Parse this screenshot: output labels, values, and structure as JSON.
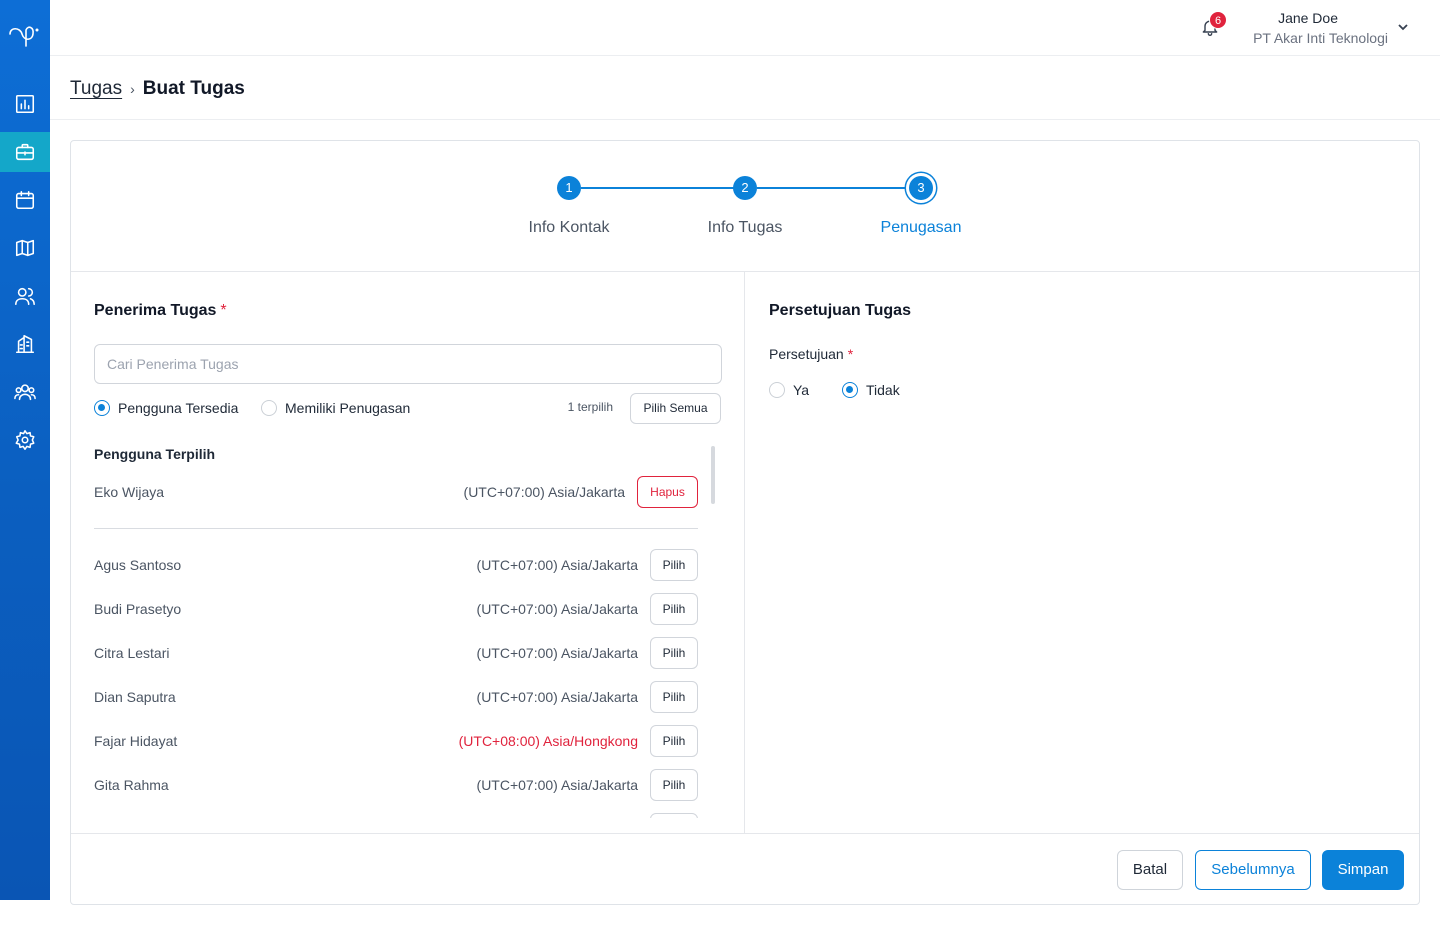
{
  "header": {
    "notification_count": "6",
    "user_name": "Jane Doe",
    "company": "PT Akar Inti Teknologi"
  },
  "breadcrumb": {
    "parent": "Tugas",
    "current": "Buat Tugas"
  },
  "stepper": {
    "steps": [
      {
        "number": "1",
        "label": "Info Kontak"
      },
      {
        "number": "2",
        "label": "Info Tugas"
      },
      {
        "number": "3",
        "label": "Penugasan"
      }
    ]
  },
  "assignee": {
    "title": "Penerima Tugas",
    "required_mark": "*",
    "search_placeholder": "Cari Penerima Tugas",
    "filter_available": "Pengguna Tersedia",
    "filter_assigned": "Memiliki Penugasan",
    "selected_count": "1 terpilih",
    "select_all": "Pilih Semua",
    "selected_title": "Pengguna Terpilih",
    "selected": [
      {
        "name": "Eko Wijaya",
        "timezone": "(UTC+07:00) Asia/Jakarta",
        "action": "Hapus"
      }
    ],
    "users": [
      {
        "name": "Agus Santoso",
        "timezone": "(UTC+07:00) Asia/Jakarta",
        "action": "Pilih"
      },
      {
        "name": "Budi Prasetyo",
        "timezone": "(UTC+07:00) Asia/Jakarta",
        "action": "Pilih"
      },
      {
        "name": "Citra Lestari",
        "timezone": "(UTC+07:00) Asia/Jakarta",
        "action": "Pilih"
      },
      {
        "name": "Dian Saputra",
        "timezone": "(UTC+07:00) Asia/Jakarta",
        "action": "Pilih"
      },
      {
        "name": "Fajar Hidayat",
        "timezone": "(UTC+08:00) Asia/Hongkong",
        "action": "Pilih"
      },
      {
        "name": "Gita Rahma",
        "timezone": "(UTC+07:00) Asia/Jakarta",
        "action": "Pilih"
      }
    ]
  },
  "approval": {
    "title": "Persetujuan Tugas",
    "label": "Persetujuan",
    "required_mark": "*",
    "option_yes": "Ya",
    "option_no": "Tidak"
  },
  "footer": {
    "cancel": "Batal",
    "previous": "Sebelumnya",
    "save": "Simpan"
  },
  "colors": {
    "primary": "#0b82d9",
    "danger": "#e0233d",
    "sidebar": "#0d6ed6",
    "sidebar_active": "#14a7c9"
  }
}
